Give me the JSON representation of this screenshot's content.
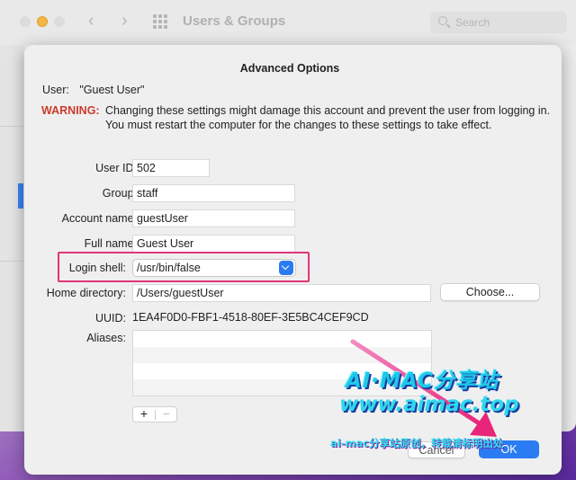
{
  "window": {
    "title": "Users & Groups",
    "search_placeholder": "Search"
  },
  "dialog": {
    "title": "Advanced Options",
    "user_label": "User:",
    "user_value": "\"Guest User\"",
    "warning_label": "WARNING:",
    "warning_text": "Changing these settings might damage this account and prevent the user from logging in. You must restart the computer for the changes to these settings to take effect.",
    "fields": {
      "user_id": {
        "label": "User ID:",
        "value": "502"
      },
      "group": {
        "label": "Group:",
        "value": "staff"
      },
      "account_name": {
        "label": "Account name:",
        "value": "guestUser"
      },
      "full_name": {
        "label": "Full name:",
        "value": "Guest User"
      },
      "login_shell": {
        "label": "Login shell:",
        "value": "/usr/bin/false"
      },
      "home_directory": {
        "label": "Home directory:",
        "value": "/Users/guestUser"
      },
      "uuid": {
        "label": "UUID:",
        "value": "1EA4F0D0-FBF1-4518-80EF-3E5BC4CEF9CD"
      },
      "aliases": {
        "label": "Aliases:"
      }
    },
    "choose_button": "Choose...",
    "add_symbol": "+",
    "remove_symbol": "−",
    "cancel_button": "Cancel",
    "ok_button": "OK"
  },
  "watermark": {
    "line1": "AI·MAC分享站",
    "line2": "www.aimac.top",
    "line3": "ai-mac分享站原创，转载请标明出处"
  },
  "colors": {
    "warning": "#cc3b2c",
    "accent": "#2b7cf2",
    "highlight": "#e0357a"
  }
}
